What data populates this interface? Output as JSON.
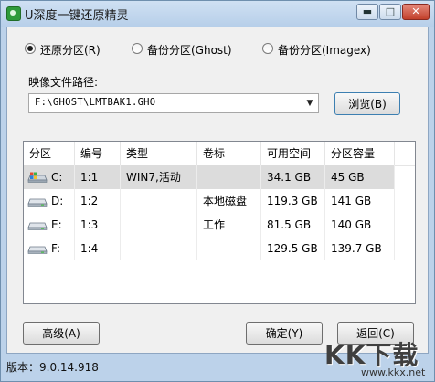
{
  "window": {
    "title": "U深度一键还原精灵",
    "minimize_glyph": "▬",
    "maximize_glyph": "□",
    "close_glyph": "✕"
  },
  "mode_options": [
    {
      "label": "还原分区(R)",
      "checked": true
    },
    {
      "label": "备份分区(Ghost)",
      "checked": false
    },
    {
      "label": "备份分区(Imagex)",
      "checked": false
    }
  ],
  "image_path": {
    "label": "映像文件路径:",
    "value": "F:\\GHOST\\LMTBAK1.GHO",
    "dropdown_glyph": "▼",
    "browse_label": "浏览(B)"
  },
  "partition_table": {
    "columns": [
      "分区",
      "编号",
      "类型",
      "卷标",
      "可用空间",
      "分区容量"
    ],
    "rows": [
      {
        "drive": "C:",
        "number": "1:1",
        "type": "WIN7,活动",
        "volume": "",
        "free": "34.1 GB",
        "capacity": "45 GB",
        "icon": "system-drive-icon",
        "selected": true
      },
      {
        "drive": "D:",
        "number": "1:2",
        "type": "",
        "volume": "本地磁盘",
        "free": "119.3 GB",
        "capacity": "141 GB",
        "icon": "drive-icon",
        "selected": false
      },
      {
        "drive": "E:",
        "number": "1:3",
        "type": "",
        "volume": "工作",
        "free": "81.5 GB",
        "capacity": "140 GB",
        "icon": "drive-icon",
        "selected": false
      },
      {
        "drive": "F:",
        "number": "1:4",
        "type": "",
        "volume": "",
        "free": "129.5 GB",
        "capacity": "139.7 GB",
        "icon": "drive-icon",
        "selected": false
      }
    ]
  },
  "buttons": {
    "advanced": "高级(A)",
    "ok": "确定(Y)",
    "back": "返回(C)"
  },
  "status": {
    "version": "版本：9.0.14.918"
  },
  "watermark": {
    "logo": "KK下载",
    "url": "www.kkx.net"
  },
  "colors": {
    "window_frame": "#bcd2ea",
    "selected_row": "#dcdcdc",
    "accent": "#3c7fb1"
  }
}
